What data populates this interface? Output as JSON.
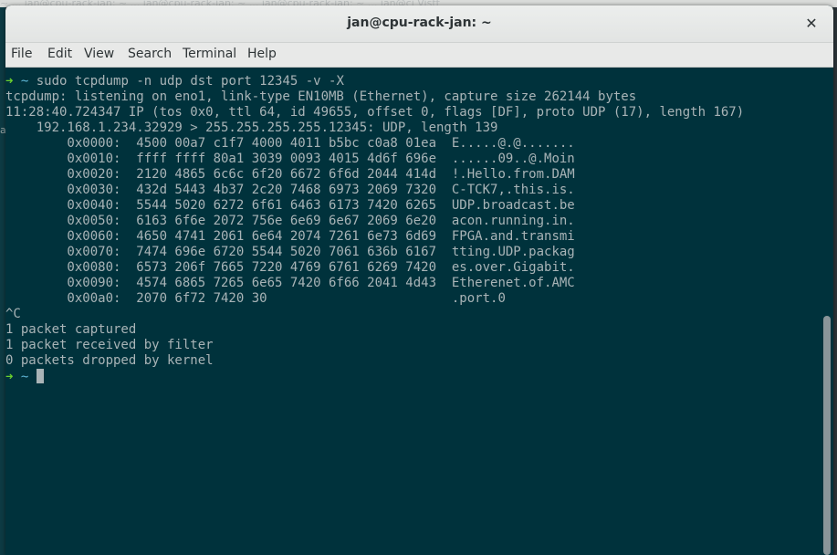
{
  "background_strip": {
    "text": "~ ... jan@cpu-rack-jan: ~ ... jan@cpu-rack-jan: ~ ... jan@cpu-rack-jan: ~ ...   jan@ci Vistt"
  },
  "window": {
    "title": "jan@cpu-rack-jan: ~"
  },
  "menu": [
    "File",
    "Edit",
    "View",
    "Search",
    "Terminal",
    "Help"
  ],
  "terminal": {
    "prompt_symbol": "➜",
    "prompt_dir": "~",
    "command": "sudo tcpdump -n udp dst port 12345 -v -X",
    "lines": [
      "tcpdump: listening on eno1, link-type EN10MB (Ethernet), capture size 262144 bytes",
      "11:28:40.724347 IP (tos 0x0, ttl 64, id 49655, offset 0, flags [DF], proto UDP (17), length 167)",
      "    192.168.1.234.32929 > 255.255.255.255.12345: UDP, length 139",
      "        0x0000:  4500 00a7 c1f7 4000 4011 b5bc c0a8 01ea  E.....@.@.......",
      "        0x0010:  ffff ffff 80a1 3039 0093 4015 4d6f 696e  ......09..@.Moin",
      "        0x0020:  2120 4865 6c6c 6f20 6672 6f6d 2044 414d  !.Hello.from.DAM",
      "        0x0030:  432d 5443 4b37 2c20 7468 6973 2069 7320  C-TCK7,.this.is.",
      "        0x0040:  5544 5020 6272 6f61 6463 6173 7420 6265  UDP.broadcast.be",
      "        0x0050:  6163 6f6e 2072 756e 6e69 6e67 2069 6e20  acon.running.in.",
      "        0x0060:  4650 4741 2061 6e64 2074 7261 6e73 6d69  FPGA.and.transmi",
      "        0x0070:  7474 696e 6720 5544 5020 7061 636b 6167  tting.UDP.packag",
      "        0x0080:  6573 206f 7665 7220 4769 6761 6269 7420  es.over.Gigabit.",
      "        0x0090:  4574 6865 7265 6e65 7420 6f66 2041 4d43  Etherenet.of.AMC",
      "        0x00a0:  2070 6f72 7420 30                        .port.0",
      "^C",
      "1 packet captured",
      "1 packet received by filter",
      "0 packets dropped by kernel"
    ]
  },
  "colors": {
    "terminal_bg": "#00323c",
    "terminal_fg": "#a9b4b7",
    "prompt_arrow": "#6bd12e",
    "prompt_dir": "#5fb6d6"
  }
}
